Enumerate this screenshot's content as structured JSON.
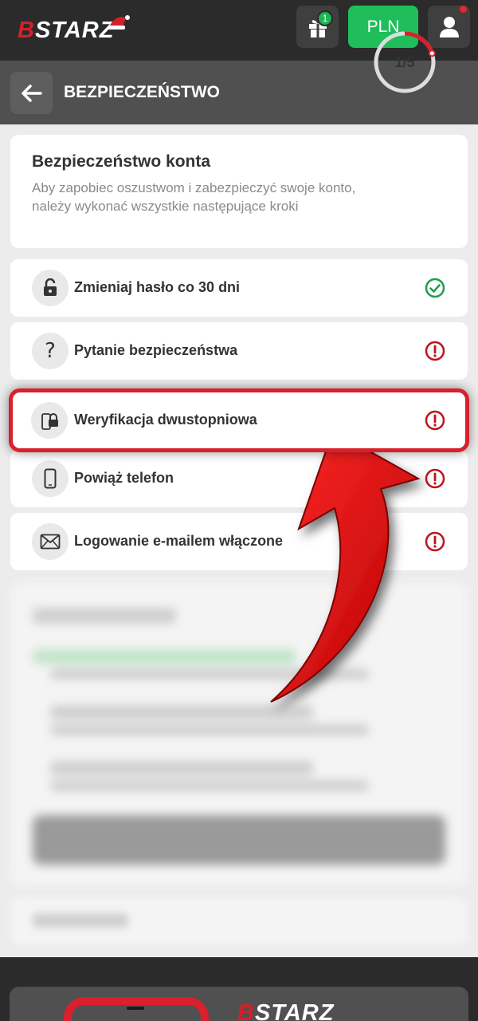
{
  "header": {
    "logo_prefix": "B",
    "logo_text": "STARZ",
    "gift_badge": "1",
    "currency": "PLN"
  },
  "titlebar": {
    "title": "BEZPIECZEŃSTWO"
  },
  "summary": {
    "heading": "Bezpieczeństwo konta",
    "description": "Aby zapobiec oszustwom i zabezpieczyć swoje konto, należy wykonać wszystkie następujące kroki",
    "progress_label": "1/5",
    "progress_fraction": 0.2
  },
  "steps": [
    {
      "label": "Zmieniaj hasło co 30 dni",
      "icon": "lock-icon",
      "status": "done"
    },
    {
      "label": "Pytanie bezpieczeństwa",
      "icon": "question-icon",
      "status": "warning"
    },
    {
      "label": "Weryfikacja dwustopniowa",
      "icon": "two-factor-icon",
      "status": "warning"
    },
    {
      "label": "Powiąż telefon",
      "icon": "phone-icon",
      "status": "warning"
    },
    {
      "label": "Logowanie e-mailem włączone",
      "icon": "envelope-icon",
      "status": "warning"
    }
  ],
  "footer": {
    "logo_prefix": "B",
    "logo_text": "STARZ"
  },
  "colors": {
    "brand_red": "#d9202c",
    "success_green": "#1fbe5a",
    "topbar": "#2b2b2b",
    "titlebar": "#505050"
  }
}
